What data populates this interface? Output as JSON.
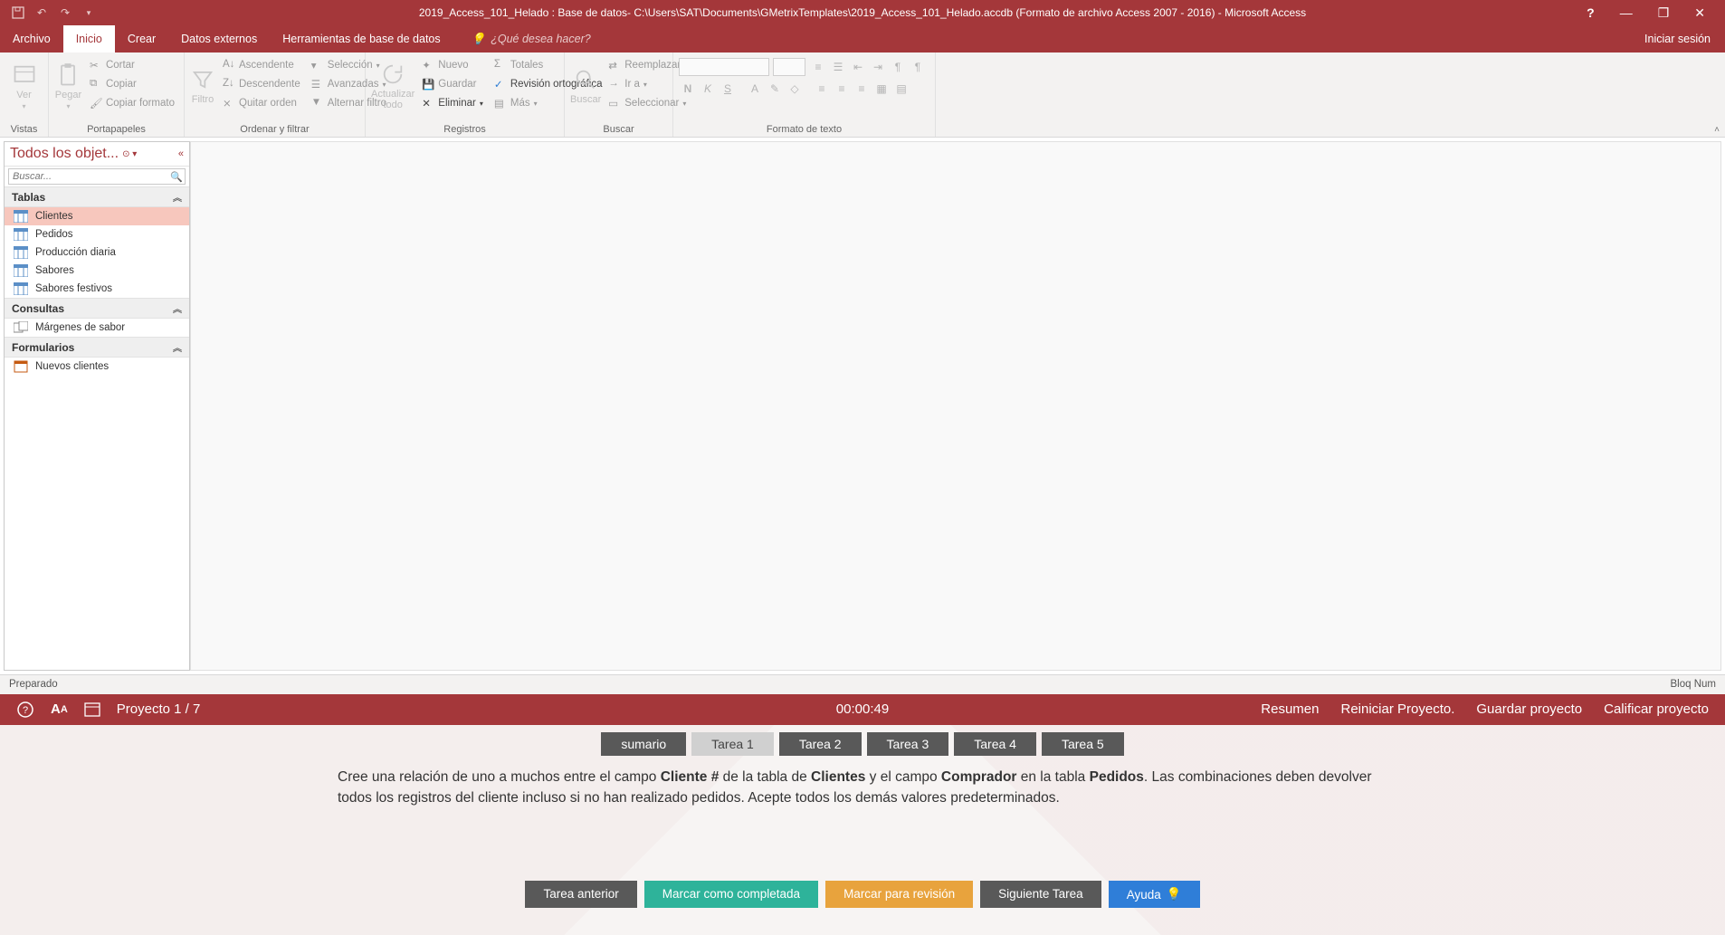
{
  "title": "2019_Access_101_Helado : Base de datos- C:\\Users\\SAT\\Documents\\GMetrixTemplates\\2019_Access_101_Helado.accdb (Formato de archivo Access 2007 - 2016) - Microsoft Access",
  "signin": "Iniciar sesión",
  "tabs": {
    "file": "Archivo",
    "home": "Inicio",
    "create": "Crear",
    "external": "Datos externos",
    "dbtools": "Herramientas de base de datos"
  },
  "tellme": "¿Qué desea hacer?",
  "ribbon": {
    "views": {
      "btn": "Ver",
      "group": "Vistas"
    },
    "clipboard": {
      "btn": "Pegar",
      "cut": "Cortar",
      "copy": "Copiar",
      "fmt": "Copiar formato",
      "group": "Portapapeles"
    },
    "sort": {
      "btn": "Filtro",
      "asc": "Ascendente",
      "desc": "Descendente",
      "clear": "Quitar orden",
      "sel": "Selección",
      "adv": "Avanzadas",
      "toggle": "Alternar filtro",
      "group": "Ordenar y filtrar"
    },
    "records": {
      "btn": "Actualizar todo",
      "new": "Nuevo",
      "save": "Guardar",
      "del": "Eliminar",
      "totals": "Totales",
      "spell": "Revisión ortográfica",
      "more": "Más",
      "group": "Registros"
    },
    "find": {
      "btn": "Buscar",
      "replace": "Reemplazar",
      "goto": "Ir a",
      "select": "Seleccionar",
      "group": "Buscar"
    },
    "text": {
      "group": "Formato de texto"
    }
  },
  "nav": {
    "title": "Todos los objet...",
    "search_ph": "Buscar...",
    "groups": {
      "tables": "Tablas",
      "queries": "Consultas",
      "forms": "Formularios"
    },
    "tables": [
      "Clientes",
      "Pedidos",
      "Producción diaria",
      "Sabores",
      "Sabores festivos"
    ],
    "queries": [
      "Márgenes de sabor"
    ],
    "forms": [
      "Nuevos clientes"
    ]
  },
  "status": {
    "left": "Preparado",
    "right": "Bloq Num"
  },
  "gm": {
    "project": "Proyecto 1 / 7",
    "timer": "00:00:49",
    "links": {
      "summary": "Resumen",
      "restart": "Reiniciar Proyecto.",
      "save": "Guardar proyecto",
      "grade": "Calificar proyecto"
    },
    "tabs": [
      "sumario",
      "Tarea 1",
      "Tarea 2",
      "Tarea 3",
      "Tarea 4",
      "Tarea 5"
    ],
    "active_tab": 1,
    "task": {
      "p1a": "Cree una relación de uno a muchos entre el campo ",
      "b1": "Cliente #",
      "p1b": " de la tabla de ",
      "b2": "Clientes",
      "p1c": " y el campo ",
      "b3": "Comprador",
      "p1d": " en la tabla ",
      "b4": "Pedidos",
      "p1e": ". Las combinaciones deben devolver todos los registros del cliente incluso si no han realizado pedidos. Acepte todos los demás valores predeterminados."
    },
    "buttons": {
      "prev": "Tarea anterior",
      "complete": "Marcar como completada",
      "review": "Marcar para revisión",
      "next": "Siguiente Tarea",
      "help": "Ayuda"
    }
  }
}
